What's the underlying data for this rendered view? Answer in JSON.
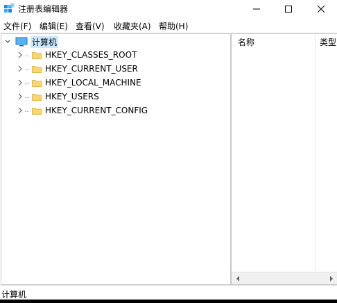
{
  "window": {
    "title": "注册表编辑器"
  },
  "menu": [
    "文件(F)",
    "编辑(E)",
    "查看(V)",
    "收藏夹(A)",
    "帮助(H)"
  ],
  "tree": {
    "root_label": "计算机",
    "children": [
      "HKEY_CLASSES_ROOT",
      "HKEY_CURRENT_USER",
      "HKEY_LOCAL_MACHINE",
      "HKEY_USERS",
      "HKEY_CURRENT_CONFIG"
    ]
  },
  "list": {
    "columns": [
      "名称",
      "类型"
    ]
  },
  "status": {
    "path": "计算机"
  },
  "colors": {
    "folder": "#f7d774",
    "folder_edge": "#e2b84a",
    "selection": "#cce8ff",
    "icon_blue": "#1e88e5"
  }
}
